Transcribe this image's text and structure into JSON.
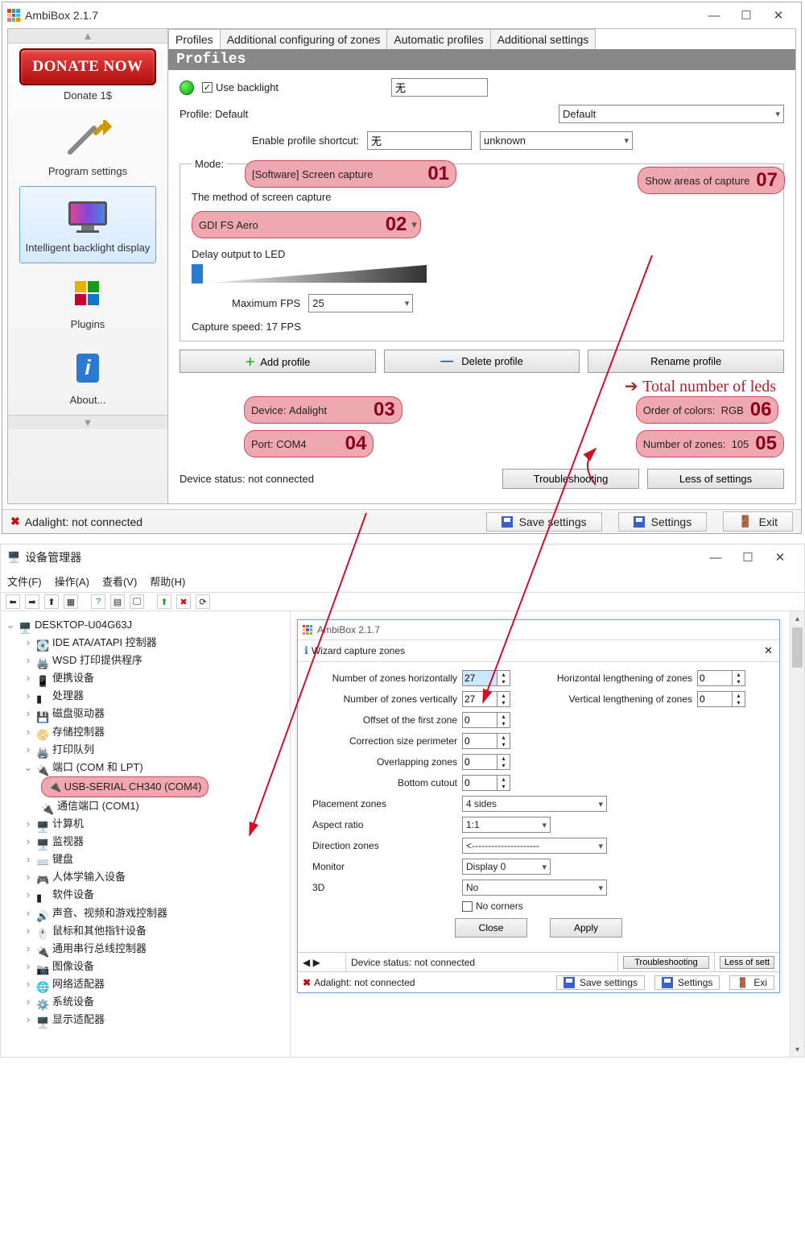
{
  "ambibox": {
    "title": "AmbiBox 2.1.7",
    "donate_btn": "DONATE NOW",
    "donate_sub": "Donate 1$",
    "nav": {
      "program_settings": "Program settings",
      "intelligent": "Intelligent backlight display",
      "plugins": "Plugins",
      "about": "About..."
    },
    "tabs": {
      "profiles": "Profiles",
      "additional_zones": "Additional configuring of zones",
      "automatic": "Automatic profiles",
      "additional_settings": "Additional settings"
    },
    "panel_title": "Profiles",
    "use_backlight": "Use backlight",
    "backlight_value": "无",
    "profile_label": "Profile: Default",
    "profile_select": "Default",
    "shortcut_label": "Enable profile shortcut:",
    "shortcut_value": "无",
    "shortcut_key": "unknown",
    "mode_label": "Mode:",
    "mode_value": "[Software] Screen capture",
    "method_label": "The method of screen capture",
    "method_value": "GDI FS Aero",
    "show_areas": "Show areas of capture",
    "delay_label": "Delay output to LED",
    "max_fps_label": "Maximum FPS",
    "max_fps_value": "25",
    "capture_speed": "Capture speed: 17 FPS",
    "add_profile": "Add profile",
    "delete_profile": "Delete profile",
    "rename_profile": "Rename profile",
    "device_label": "Device:",
    "device_value": "Adalight",
    "port_label": "Port:",
    "port_value": "COM4",
    "order_label": "Order of colors:",
    "order_value": "RGB",
    "zones_label": "Number of zones:",
    "zones_value": "105",
    "dev_status": "Device status: not connected",
    "troubleshooting": "Troubleshooting",
    "less_settings": "Less of settings",
    "status_adalight": "Adalight: not connected",
    "save_settings": "Save settings",
    "settings": "Settings",
    "exit": "Exit",
    "annot_total": "Total number of leds",
    "marks": {
      "m1": "01",
      "m2": "02",
      "m3": "03",
      "m4": "04",
      "m5": "05",
      "m6": "06",
      "m7": "07"
    }
  },
  "dm": {
    "title": "设备管理器",
    "menu": {
      "file": "文件(F)",
      "action": "操作(A)",
      "view": "查看(V)",
      "help": "帮助(H)"
    },
    "root": "DESKTOP-U04G63J",
    "nodes": {
      "ide": "IDE ATA/ATAPI 控制器",
      "wsd": "WSD 打印提供程序",
      "portable": "便携设备",
      "cpu": "处理器",
      "disk": "磁盘驱动器",
      "storage": "存储控制器",
      "printq": "打印队列",
      "ports": "端口 (COM 和 LPT)",
      "com4": "USB-SERIAL CH340 (COM4)",
      "com1": "通信端口 (COM1)",
      "computer": "计算机",
      "monitor": "监视器",
      "keyboard": "键盘",
      "hid": "人体学输入设备",
      "software": "软件设备",
      "sound": "声音、视频和游戏控制器",
      "mouse": "鼠标和其他指针设备",
      "usb": "通用串行总线控制器",
      "image": "图像设备",
      "net": "网络适配器",
      "sys": "系统设备",
      "display": "显示适配器"
    }
  },
  "wiz": {
    "title": "AmbiBox 2.1.7",
    "subtitle": "Wizard capture zones",
    "fields": {
      "h_zones_l": "Number of zones horizontally",
      "h_zones_v": "27",
      "hlen_l": "Horizontal lengthening of zones",
      "hlen_v": "0",
      "v_zones_l": "Number of zones vertically",
      "v_zones_v": "27",
      "vlen_l": "Vertical lengthening of zones",
      "vlen_v": "0",
      "offset_l": "Offset of the first zone",
      "offset_v": "0",
      "corr_l": "Correction size perimeter",
      "corr_v": "0",
      "overlap_l": "Overlapping zones",
      "overlap_v": "0",
      "bottom_l": "Bottom cutout",
      "bottom_v": "0",
      "placement_l": "Placement zones",
      "placement_v": "4 sides",
      "aspect_l": "Aspect ratio",
      "aspect_v": "1:1",
      "dir_l": "Direction zones",
      "dir_v": "<---------------------",
      "monitor_l": "Monitor",
      "monitor_v": "Display 0",
      "threeD_l": "3D",
      "threeD_v": "No",
      "nocorners": "No corners"
    },
    "close": "Close",
    "apply": "Apply",
    "dev_status": "Device status: not connected",
    "troubleshooting": "Troubleshooting",
    "less": "Less of sett",
    "adalight": "Adalight: not connected",
    "save": "Save settings",
    "settings": "Settings",
    "exit": "Exi"
  }
}
